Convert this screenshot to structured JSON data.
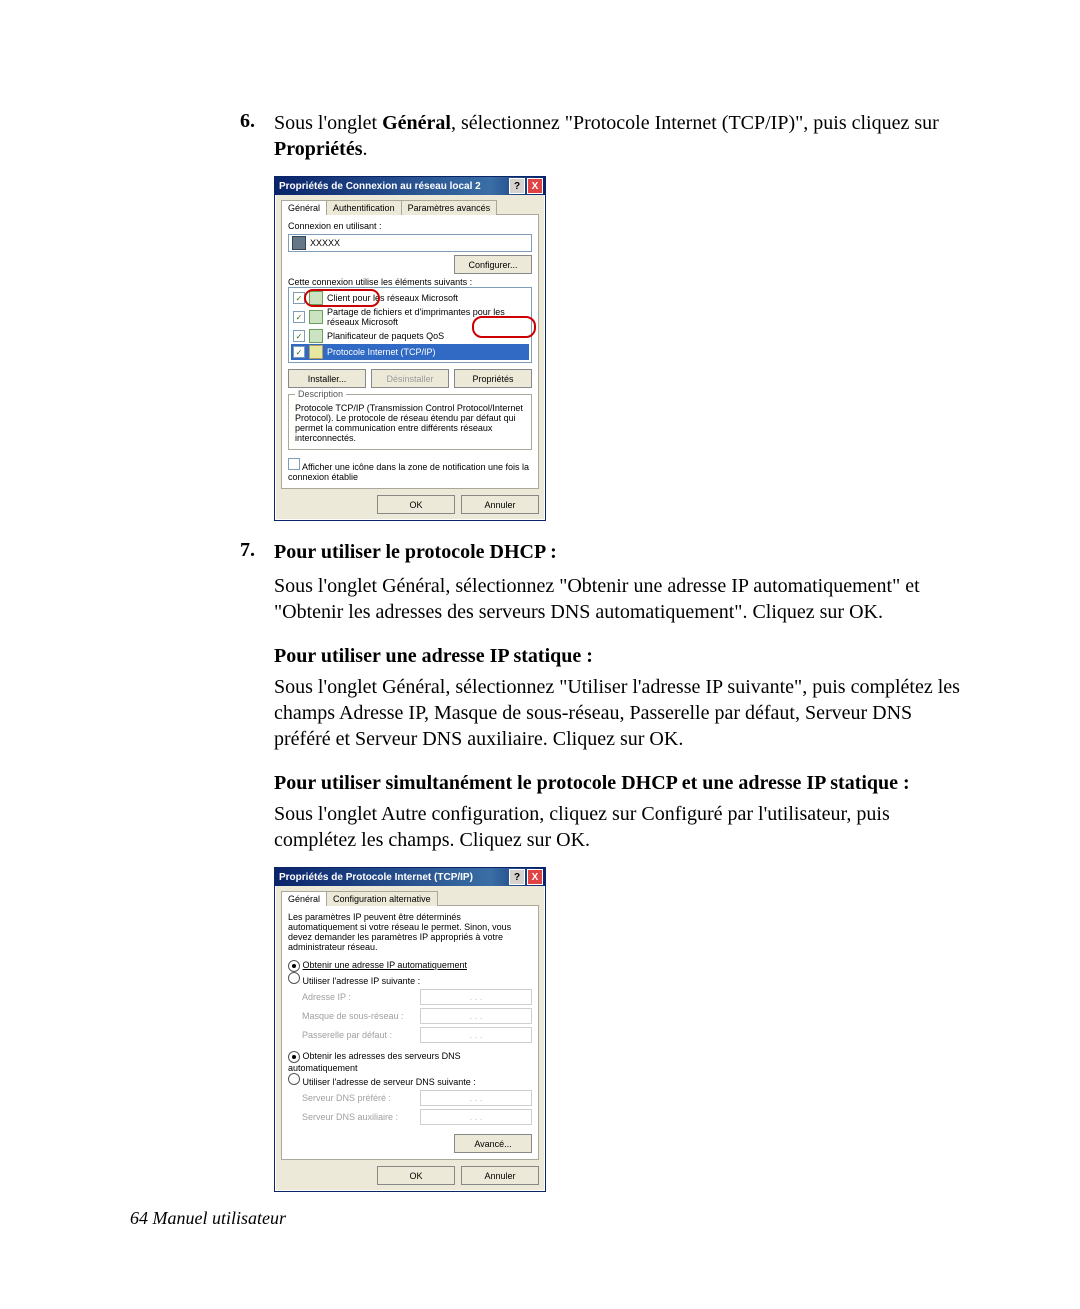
{
  "step6": {
    "num": "6.",
    "a": "Sous l'onglet ",
    "b1": "Général",
    "c": ", sélectionnez \"Protocole Internet (TCP/IP)\", puis cliquez sur ",
    "b2": "Propriétés",
    "d": "."
  },
  "step7": {
    "num": "7.",
    "head": "Pour utiliser le protocole DHCP :",
    "p_a": "Sous l'onglet ",
    "p_b1": "Général",
    "p_c": ", sélectionnez \"Obtenir une adresse IP automatiquement\" et \"Obtenir les adresses des serveurs DNS automatiquement\". Cliquez sur ",
    "p_b2": "OK",
    "p_d": "."
  },
  "static": {
    "head": "Pour utiliser une adresse IP statique :",
    "a": "Sous l'onglet ",
    "b1": "Général",
    "c": ", sélectionnez \"Utiliser l'adresse IP suivante\", puis complétez les champs Adresse IP, Masque de sous-réseau, Passerelle par défaut, Serveur DNS préféré et Serveur DNS auxiliaire. Cliquez sur ",
    "b2": "OK",
    "d": "."
  },
  "both": {
    "head": "Pour utiliser simultanément le protocole DHCP et une adresse IP statique :",
    "a": "Sous l'onglet ",
    "b1": "Autre configuration",
    "c": ", cliquez sur ",
    "b2": "Configuré par l'utilisateur",
    "d": ", puis complétez les champs. Cliquez sur ",
    "b3": "OK",
    "e": "."
  },
  "footer": "64  Manuel utilisateur",
  "dlg1": {
    "title": "Propriétés de Connexion au réseau local 2",
    "tabs": {
      "general": "Général",
      "auth": "Authentification",
      "adv": "Paramètres avancés"
    },
    "connect_label": "Connexion en utilisant :",
    "adapter": "XXXXX",
    "configure": "Configurer...",
    "uses_label": "Cette connexion utilise les éléments suivants :",
    "items": {
      "i1": "Client pour les réseaux Microsoft",
      "i2": "Partage de fichiers et d'imprimantes pour les réseaux Microsoft",
      "i3": "Planificateur de paquets QoS",
      "i4": "Protocole Internet (TCP/IP)"
    },
    "install": "Installer...",
    "uninstall": "Désinstaller",
    "properties": "Propriétés",
    "desc_head": "Description",
    "desc": "Protocole TCP/IP (Transmission Control Protocol/Internet Protocol). Le protocole de réseau étendu par défaut qui permet la communication entre différents réseaux interconnectés.",
    "notify": "Afficher une icône dans la zone de notification une fois la connexion établie",
    "ok": "OK",
    "cancel": "Annuler",
    "help": "?",
    "close": "X"
  },
  "dlg2": {
    "title": "Propriétés de Protocole Internet (TCP/IP)",
    "tabs": {
      "general": "Général",
      "alt": "Configuration alternative"
    },
    "intro": "Les paramètres IP peuvent être déterminés automatiquement si votre réseau le permet. Sinon, vous devez demander les paramètres IP appropriés à votre administrateur réseau.",
    "r_auto_ip": "Obtenir une adresse IP automatiquement",
    "r_man_ip": "Utiliser l'adresse IP suivante :",
    "f_ip": "Adresse IP :",
    "f_mask": "Masque de sous-réseau :",
    "f_gw": "Passerelle par défaut :",
    "r_auto_dns": "Obtenir les adresses des serveurs DNS automatiquement",
    "r_man_dns": "Utiliser l'adresse de serveur DNS suivante :",
    "f_dns1": "Serveur DNS préféré :",
    "f_dns2": "Serveur DNS auxiliaire :",
    "advanced": "Avancé...",
    "ok": "OK",
    "cancel": "Annuler",
    "help": "?",
    "close": "X",
    "placeholder": ". . ."
  }
}
